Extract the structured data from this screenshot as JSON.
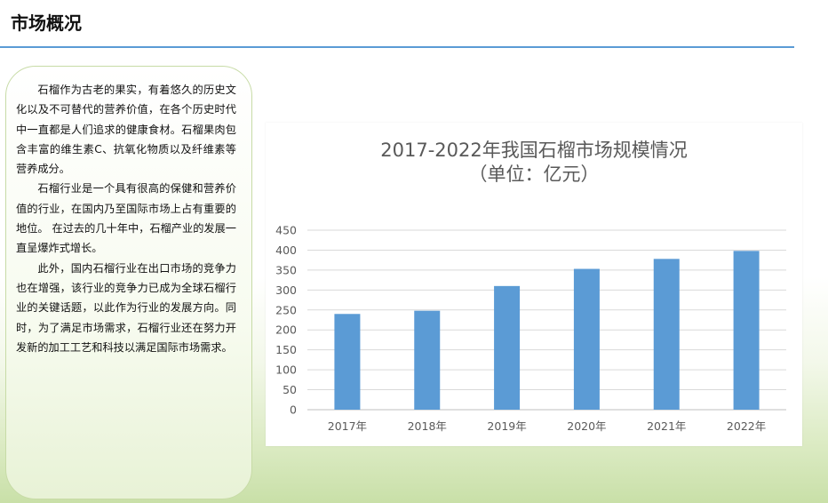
{
  "header": {
    "title": "市场概况"
  },
  "panel": {
    "paragraphs": [
      "石榴作为古老的果实，有着悠久的历史文化以及不可替代的营养价值，在各个历史时代中一直都是人们追求的健康食材。石榴果肉包含丰富的维生素C、抗氧化物质以及纤维素等营养成分。",
      "石榴行业是一个具有很高的保健和营养价值的行业，在国内乃至国际市场上占有重要的地位。 在过去的几十年中，石榴产业的发展一直呈爆炸式增长。",
      "此外，国内石榴行业在出口市场的竞争力也在增强，该行业的竞争力已成为全球石榴行业的关键话题，以此作为行业的发展方向。同时，为了满足市场需求，石榴行业还在努力开发新的加工工艺和科技以满足国际市场需求。"
    ]
  },
  "chart_data": {
    "type": "bar",
    "title": "2017-2022年我国石榴市场规模情况",
    "subtitle": "（单位：亿元）",
    "categories": [
      "2017年",
      "2018年",
      "2019年",
      "2020年",
      "2021年",
      "2022年"
    ],
    "values": [
      240,
      248,
      310,
      353,
      378,
      398
    ],
    "ylim": [
      0,
      450
    ],
    "yticks": [
      0,
      50,
      100,
      150,
      200,
      250,
      300,
      350,
      400,
      450
    ],
    "xlabel": "",
    "ylabel": "",
    "grid": true,
    "legend": "none",
    "bar_color": "#5b9bd5",
    "grid_color": "#d9d9d9"
  }
}
